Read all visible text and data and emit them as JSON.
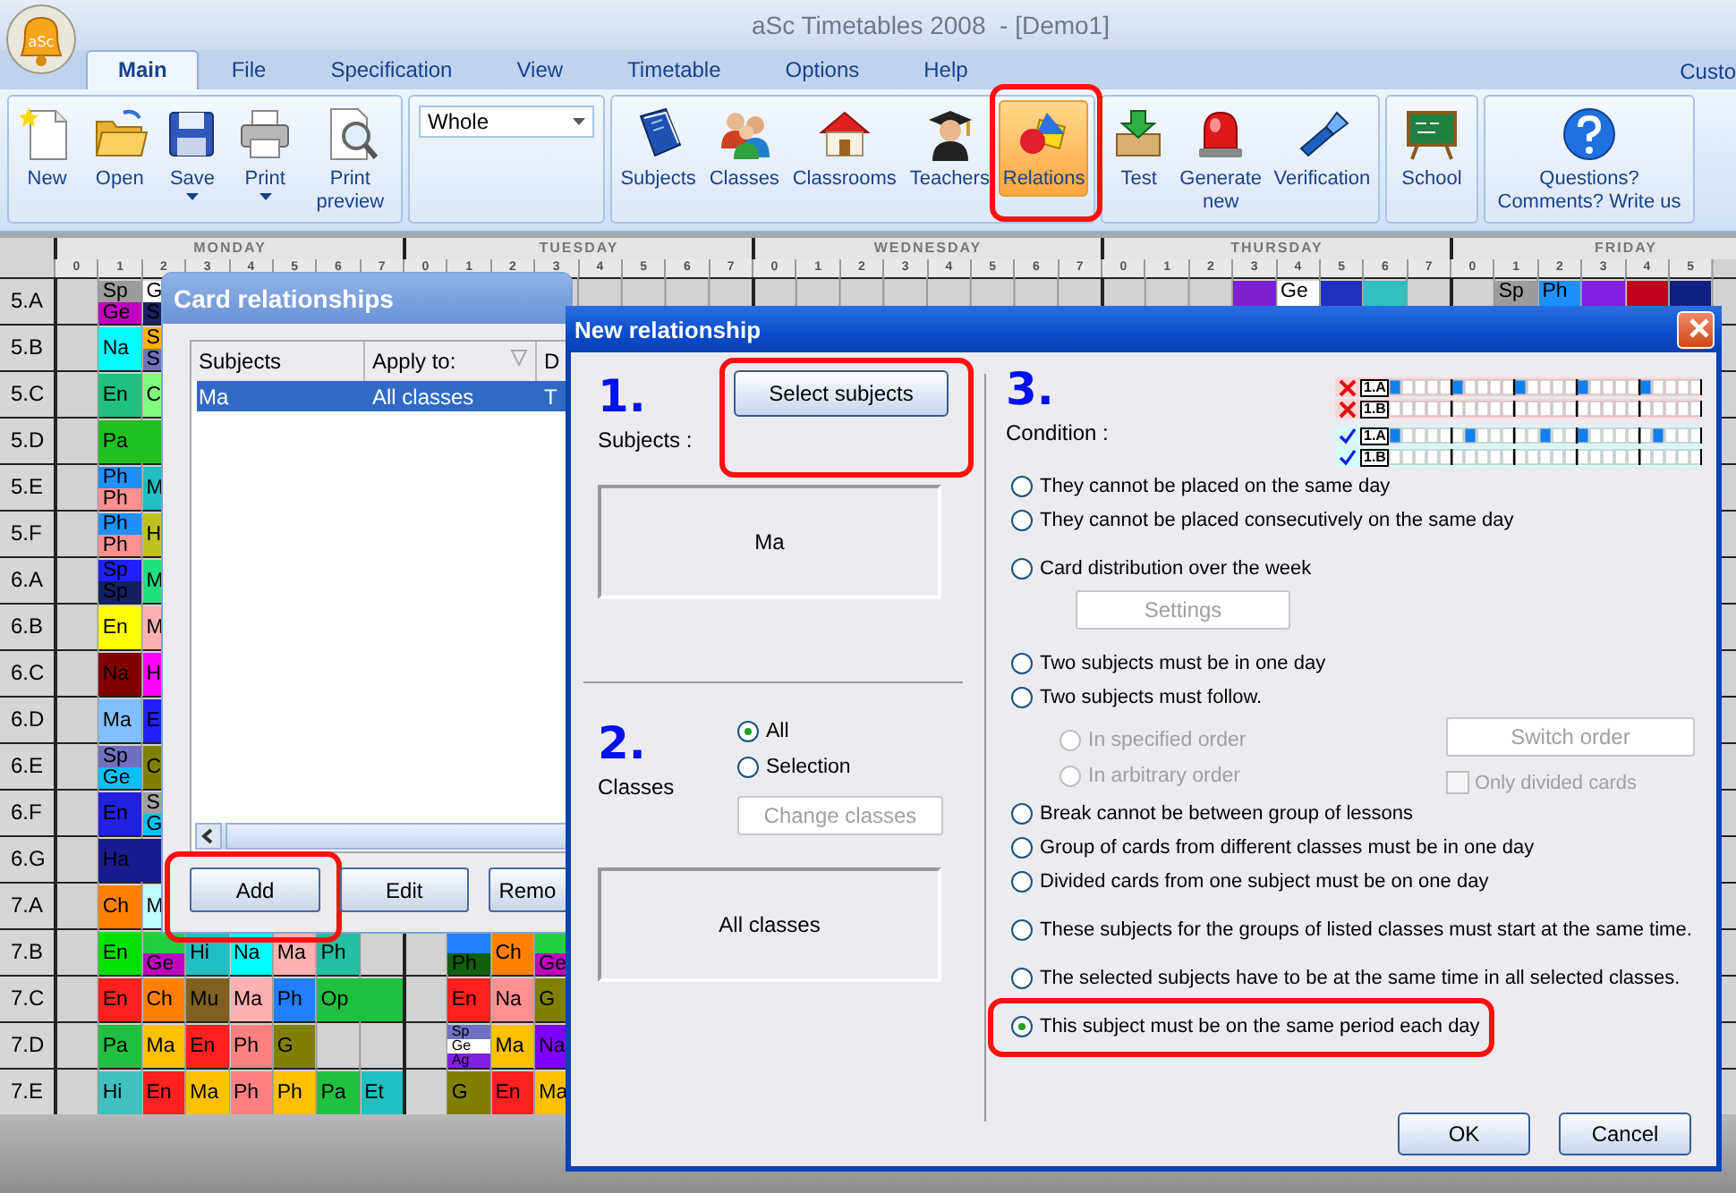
{
  "app_logo": {
    "text": "aSc"
  },
  "window": {
    "title": "aSc Timetables 2008  - [Demo1]"
  },
  "menu_tabs": [
    {
      "label": "Main",
      "selected": true
    },
    {
      "label": "File",
      "selected": false
    },
    {
      "label": "Specification",
      "selected": false
    },
    {
      "label": "View",
      "selected": false
    },
    {
      "label": "Timetable",
      "selected": false
    },
    {
      "label": "Options",
      "selected": false
    },
    {
      "label": "Help",
      "selected": false
    }
  ],
  "menu_right": "Custo",
  "ribbon": [
    {
      "items": [
        {
          "kind": "button",
          "label": "New",
          "selected": false,
          "has_menu": false,
          "highlighted": false
        },
        {
          "kind": "button",
          "label": "Open",
          "selected": false,
          "has_menu": false,
          "highlighted": false
        },
        {
          "kind": "button",
          "label": "Save",
          "selected": false,
          "has_menu": true,
          "highlighted": false
        },
        {
          "kind": "button",
          "label": "Print",
          "selected": false,
          "has_menu": true,
          "highlighted": false
        },
        {
          "kind": "button",
          "label": "Print preview",
          "selected": false,
          "has_menu": false,
          "highlighted": false
        }
      ]
    },
    {
      "items": [
        {
          "kind": "select",
          "value": "Whole"
        }
      ]
    },
    {
      "items": [
        {
          "kind": "button",
          "label": "Subjects",
          "selected": false,
          "has_menu": false,
          "highlighted": false
        },
        {
          "kind": "button",
          "label": "Classes",
          "selected": false,
          "has_menu": false,
          "highlighted": false
        },
        {
          "kind": "button",
          "label": "Classrooms",
          "selected": false,
          "has_menu": false,
          "highlighted": false
        },
        {
          "kind": "button",
          "label": "Teachers",
          "selected": false,
          "has_menu": false,
          "highlighted": false
        },
        {
          "kind": "button",
          "label": "Relations",
          "selected": true,
          "has_menu": false,
          "highlighted": true
        }
      ]
    },
    {
      "items": [
        {
          "kind": "button",
          "label": "Test",
          "selected": false,
          "has_menu": false,
          "highlighted": false
        },
        {
          "kind": "button",
          "label": "Generate new",
          "selected": false,
          "has_menu": false,
          "highlighted": false
        },
        {
          "kind": "button",
          "label": "Verification",
          "selected": false,
          "has_menu": false,
          "highlighted": false
        }
      ]
    },
    {
      "items": [
        {
          "kind": "button",
          "label": "School",
          "selected": false,
          "has_menu": false,
          "highlighted": false
        }
      ]
    },
    {
      "items": [
        {
          "kind": "button",
          "label": "Questions? Comments? Write us",
          "selected": false,
          "has_menu": false,
          "highlighted": false
        }
      ]
    }
  ],
  "timetable": {
    "days": [
      {
        "name": "MONDAY",
        "periods": [
          "0",
          "1",
          "2",
          "3",
          "4",
          "5",
          "6",
          "7"
        ]
      },
      {
        "name": "TUESDAY",
        "periods": [
          "0",
          "1",
          "2",
          "3",
          "4",
          "5",
          "6",
          "7"
        ]
      },
      {
        "name": "WEDNESDAY",
        "periods": [
          "0",
          "1",
          "2",
          "3",
          "4",
          "5",
          "6",
          "7"
        ]
      },
      {
        "name": "THURSDAY",
        "periods": [
          "0",
          "1",
          "2",
          "3",
          "4",
          "5",
          "6",
          "7"
        ]
      },
      {
        "name": "FRIDAY",
        "periods": [
          "0",
          "1",
          "2",
          "3",
          "4",
          "5"
        ]
      }
    ],
    "rows": [
      {
        "label": "5.A",
        "monday": [
          {
            "kind": "empty"
          },
          {
            "kind": "single",
            "parts": [
              {
                "text": "Sp",
                "color": "#9c9c9c"
              },
              {
                "text": "Ge",
                "color": "#c000c0"
              }
            ]
          },
          {
            "kind": "single",
            "parts": [
              {
                "text": "G",
                "color": "#ffffff"
              },
              {
                "text": "S",
                "color": "#1a2060"
              }
            ]
          }
        ],
        "thursday": [
          {
            "kind": "empty"
          },
          {
            "kind": "empty"
          },
          {
            "kind": "empty"
          },
          {
            "kind": "single",
            "parts": [
              {
                "color": "#7a20d0"
              },
              {
                "color": "#7a20d0"
              }
            ]
          },
          {
            "kind": "single",
            "parts": [
              {
                "text": "Ge",
                "color": "#ffffff"
              },
              {
                "color": "#ffffff"
              }
            ]
          },
          {
            "kind": "single",
            "parts": [
              {
                "color": "#2030c0"
              },
              {
                "color": "#2030c0"
              }
            ]
          },
          {
            "kind": "single",
            "parts": [
              {
                "color": "#30c0c0"
              },
              {
                "color": "#30c0c0"
              }
            ]
          }
        ],
        "friday": [
          {
            "kind": "empty"
          },
          {
            "kind": "single",
            "parts": [
              {
                "text": "Sp",
                "color": "#9c9c9c"
              },
              {
                "color": "#9c9c9c"
              }
            ]
          },
          {
            "kind": "single",
            "parts": [
              {
                "text": "Ph",
                "color": "#2090ff"
              },
              {
                "color": "#2090ff"
              }
            ]
          },
          {
            "kind": "single",
            "parts": [
              {
                "color": "#8020e0"
              },
              {
                "color": "#8020e0"
              }
            ]
          },
          {
            "kind": "single",
            "parts": [
              {
                "color": "#c00020"
              },
              {
                "color": "#c00020"
              }
            ]
          },
          {
            "kind": "single",
            "parts": [
              {
                "color": "#102080"
              },
              {
                "color": "#102080"
              }
            ]
          }
        ]
      },
      {
        "label": "5.B",
        "monday": [
          {
            "kind": "empty"
          },
          {
            "kind": "single",
            "parts": [
              {
                "text": "Na",
                "color": "#00ffff"
              }
            ]
          },
          {
            "kind": "single",
            "parts": [
              {
                "text": "S",
                "color": "#ffb000"
              },
              {
                "text": "S",
                "color": "#7070c0"
              }
            ]
          }
        ]
      },
      {
        "label": "5.C",
        "monday": [
          {
            "kind": "empty"
          },
          {
            "kind": "single",
            "parts": [
              {
                "text": "En",
                "color": "#20c080"
              }
            ]
          },
          {
            "kind": "single",
            "parts": [
              {
                "text": "C",
                "color": "#80ff80"
              }
            ]
          }
        ]
      },
      {
        "label": "5.D",
        "monday": [
          {
            "kind": "empty"
          },
          {
            "kind": "double",
            "parts": [
              {
                "text": "Pa",
                "color": "#20c020"
              }
            ]
          }
        ]
      },
      {
        "label": "5.E",
        "monday": [
          {
            "kind": "empty"
          },
          {
            "kind": "single",
            "parts": [
              {
                "text": "Ph",
                "color": "#2090ff"
              },
              {
                "text": "Ph",
                "color": "#ff9090"
              }
            ]
          },
          {
            "kind": "single",
            "parts": [
              {
                "text": "M",
                "color": "#20c0c0"
              }
            ]
          }
        ]
      },
      {
        "label": "5.F",
        "monday": [
          {
            "kind": "empty"
          },
          {
            "kind": "single",
            "parts": [
              {
                "text": "Ph",
                "color": "#2090ff"
              },
              {
                "text": "Ph",
                "color": "#ff9090"
              }
            ]
          },
          {
            "kind": "single",
            "parts": [
              {
                "text": "H",
                "color": "#c0c020"
              }
            ]
          }
        ]
      },
      {
        "label": "6.A",
        "monday": [
          {
            "kind": "empty"
          },
          {
            "kind": "single",
            "parts": [
              {
                "text": "Sp",
                "color": "#2020ff"
              },
              {
                "text": "Sp",
                "color": "#102060"
              }
            ]
          },
          {
            "kind": "single",
            "parts": [
              {
                "text": "M",
                "color": "#20e080"
              }
            ]
          }
        ]
      },
      {
        "label": "6.B",
        "monday": [
          {
            "kind": "empty"
          },
          {
            "kind": "single",
            "parts": [
              {
                "text": "En",
                "color": "#ffff00"
              }
            ]
          },
          {
            "kind": "single",
            "parts": [
              {
                "text": "M",
                "color": "#ffb0b0"
              }
            ]
          }
        ]
      },
      {
        "label": "6.C",
        "monday": [
          {
            "kind": "empty"
          },
          {
            "kind": "single",
            "parts": [
              {
                "text": "Na",
                "color": "#800000"
              }
            ]
          },
          {
            "kind": "single",
            "parts": [
              {
                "text": "H",
                "color": "#ff00ff"
              }
            ]
          }
        ]
      },
      {
        "label": "6.D",
        "monday": [
          {
            "kind": "empty"
          },
          {
            "kind": "single",
            "parts": [
              {
                "text": "Ma",
                "color": "#80c0ff"
              }
            ]
          },
          {
            "kind": "single",
            "parts": [
              {
                "text": "E",
                "color": "#2020ff"
              }
            ]
          }
        ]
      },
      {
        "label": "6.E",
        "monday": [
          {
            "kind": "empty"
          },
          {
            "kind": "single",
            "parts": [
              {
                "text": "Sp",
                "color": "#7070c0"
              },
              {
                "text": "Ge",
                "color": "#00c0ff"
              }
            ]
          },
          {
            "kind": "single",
            "parts": [
              {
                "text": "C",
                "color": "#808000"
              }
            ]
          }
        ]
      },
      {
        "label": "6.F",
        "monday": [
          {
            "kind": "empty"
          },
          {
            "kind": "single",
            "parts": [
              {
                "text": "En",
                "color": "#2020e0"
              }
            ]
          },
          {
            "kind": "single",
            "parts": [
              {
                "text": "S",
                "color": "#a0a0a0"
              },
              {
                "text": "G",
                "color": "#00c0ff"
              }
            ]
          }
        ]
      },
      {
        "label": "6.G",
        "monday": [
          {
            "kind": "empty"
          },
          {
            "kind": "double",
            "parts": [
              {
                "text": "Ha",
                "color": "#1a1a90"
              }
            ]
          }
        ]
      },
      {
        "label": "7.A",
        "monday": [
          {
            "kind": "empty"
          },
          {
            "kind": "single",
            "parts": [
              {
                "text": "Ch",
                "color": "#ff8000"
              }
            ]
          },
          {
            "kind": "single",
            "parts": [
              {
                "text": "M",
                "color": "#c0ffff"
              }
            ]
          }
        ]
      },
      {
        "label": "7.B",
        "monday": [
          {
            "kind": "empty"
          },
          {
            "kind": "single",
            "parts": [
              {
                "text": "En",
                "color": "#00e000"
              }
            ]
          },
          {
            "kind": "single",
            "parts": [
              {
                "color": "#20d040"
              },
              {
                "text": "Ge",
                "color": "#c000c0"
              }
            ]
          },
          {
            "kind": "single",
            "parts": [
              {
                "text": "Hi",
                "color": "#20c0c0"
              }
            ]
          },
          {
            "kind": "single",
            "parts": [
              {
                "text": "Na",
                "color": "#00ffff"
              }
            ]
          },
          {
            "kind": "single",
            "parts": [
              {
                "text": "Ma",
                "color": "#ffb0b0"
              }
            ]
          },
          {
            "kind": "single",
            "parts": [
              {
                "text": "Ph",
                "color": "#20c0a0"
              }
            ]
          }
        ],
        "tuesday": [
          {
            "kind": "empty"
          },
          {
            "kind": "single",
            "parts": [
              {
                "color": "#2080ff"
              },
              {
                "text": "Ph",
                "color": "#106010"
              }
            ]
          },
          {
            "kind": "single",
            "parts": [
              {
                "text": "Ch",
                "color": "#ff8000"
              }
            ]
          },
          {
            "kind": "single",
            "parts": [
              {
                "color": "#20d040"
              },
              {
                "text": "Ge",
                "color": "#c000c0"
              }
            ]
          }
        ]
      },
      {
        "label": "7.C",
        "monday": [
          {
            "kind": "empty"
          },
          {
            "kind": "single",
            "parts": [
              {
                "text": "En",
                "color": "#ff2020"
              }
            ]
          },
          {
            "kind": "single",
            "parts": [
              {
                "text": "Ch",
                "color": "#ff8000"
              }
            ]
          },
          {
            "kind": "single",
            "parts": [
              {
                "text": "Mu",
                "color": "#806020"
              }
            ]
          },
          {
            "kind": "single",
            "parts": [
              {
                "text": "Ma",
                "color": "#ffb0b0"
              }
            ]
          },
          {
            "kind": "single",
            "parts": [
              {
                "text": "Ph",
                "color": "#2080ff"
              }
            ]
          },
          {
            "kind": "double",
            "parts": [
              {
                "text": "Op",
                "color": "#20c040"
              }
            ]
          }
        ],
        "tuesday": [
          {
            "kind": "empty"
          },
          {
            "kind": "single",
            "parts": [
              {
                "text": "En",
                "color": "#ff2020"
              }
            ]
          },
          {
            "kind": "single",
            "parts": [
              {
                "text": "Na",
                "color": "#ff9090"
              }
            ]
          },
          {
            "kind": "single",
            "parts": [
              {
                "text": "G",
                "color": "#808000"
              }
            ]
          }
        ]
      },
      {
        "label": "7.D",
        "monday": [
          {
            "kind": "empty"
          },
          {
            "kind": "single",
            "parts": [
              {
                "text": "Pa",
                "color": "#20c040"
              }
            ]
          },
          {
            "kind": "single",
            "parts": [
              {
                "text": "Ma",
                "color": "#ffc000"
              }
            ]
          },
          {
            "kind": "single",
            "parts": [
              {
                "text": "En",
                "color": "#ff2020"
              }
            ]
          },
          {
            "kind": "single",
            "parts": [
              {
                "text": "Ph",
                "color": "#ff8080"
              }
            ]
          },
          {
            "kind": "single",
            "parts": [
              {
                "text": "G",
                "color": "#808000"
              }
            ]
          }
        ],
        "tuesday": [
          {
            "kind": "empty"
          },
          {
            "kind": "single",
            "parts": [
              {
                "text": "Sp",
                "color": "#7070c0"
              },
              {
                "text": "Ge",
                "color": "#ffffff"
              },
              {
                "text": "Ag",
                "color": "#8020e0"
              }
            ]
          },
          {
            "kind": "single",
            "parts": [
              {
                "text": "Ma",
                "color": "#ffc000"
              }
            ]
          },
          {
            "kind": "single",
            "parts": [
              {
                "text": "Na",
                "color": "#8000ff"
              }
            ]
          }
        ]
      },
      {
        "label": "7.E",
        "monday": [
          {
            "kind": "empty"
          },
          {
            "kind": "single",
            "parts": [
              {
                "text": "Hi",
                "color": "#40c0c0"
              }
            ]
          },
          {
            "kind": "single",
            "parts": [
              {
                "text": "En",
                "color": "#ff2020"
              }
            ]
          },
          {
            "kind": "single",
            "parts": [
              {
                "text": "Ma",
                "color": "#ffc000"
              }
            ]
          },
          {
            "kind": "single",
            "parts": [
              {
                "text": "Ph",
                "color": "#ff8080"
              }
            ]
          },
          {
            "kind": "single",
            "parts": [
              {
                "text": "Ph",
                "color": "#ffc000"
              }
            ]
          },
          {
            "kind": "single",
            "parts": [
              {
                "text": "Pa",
                "color": "#20c040"
              }
            ]
          },
          {
            "kind": "single",
            "parts": [
              {
                "text": "Et",
                "color": "#20c0c0"
              }
            ]
          }
        ],
        "tuesday": [
          {
            "kind": "empty"
          },
          {
            "kind": "single",
            "parts": [
              {
                "text": "G",
                "color": "#808000"
              }
            ]
          },
          {
            "kind": "single",
            "parts": [
              {
                "text": "En",
                "color": "#ff2020"
              }
            ]
          },
          {
            "kind": "single",
            "parts": [
              {
                "text": "Ma",
                "color": "#ffc000"
              }
            ]
          }
        ]
      }
    ]
  },
  "card_relationships": {
    "title": "Card relationships",
    "columns": [
      "Subjects",
      "Apply to:",
      "D"
    ],
    "rows": [
      {
        "cells": [
          "Ma",
          "All classes",
          "T"
        ],
        "selected": true
      }
    ],
    "buttons": [
      {
        "label": "Add",
        "highlighted": true
      },
      {
        "label": "Edit"
      },
      {
        "label": "Remo"
      }
    ]
  },
  "new_relationship": {
    "title": "New relationship",
    "subjects": {
      "number": "1.",
      "label": "Subjects :",
      "button": {
        "label": "Select subjects",
        "highlighted": true
      },
      "value": "Ma"
    },
    "classes": {
      "number": "2.",
      "label": "Classes",
      "options": [
        {
          "label": "All",
          "selected": true
        },
        {
          "label": "Selection",
          "selected": false
        }
      ],
      "button": {
        "label": "Change classes",
        "disabled": true
      },
      "value": "All classes"
    },
    "condition": {
      "number": "3.",
      "label": "Condition :",
      "example": [
        {
          "label": "1.A",
          "allowed": false,
          "filled": [
            true,
            false,
            false,
            false,
            false,
            true,
            false,
            false,
            false,
            false,
            true,
            false,
            false,
            false,
            false,
            true,
            false,
            false,
            false,
            false,
            true,
            false,
            false,
            false,
            false
          ]
        },
        {
          "label": "1.B",
          "allowed": false,
          "filled": [
            false,
            false,
            false,
            false,
            false,
            false,
            false,
            false,
            false,
            false,
            false,
            false,
            false,
            false,
            false,
            false,
            false,
            false,
            false,
            false,
            false,
            false,
            false,
            false,
            false
          ]
        },
        {
          "label": "1.A",
          "allowed": true,
          "filled": [
            true,
            false,
            false,
            false,
            false,
            false,
            true,
            false,
            false,
            false,
            false,
            false,
            true,
            false,
            false,
            true,
            false,
            false,
            false,
            false,
            false,
            true,
            false,
            false,
            false
          ]
        },
        {
          "label": "1.B",
          "allowed": true,
          "filled": [
            false,
            false,
            false,
            false,
            false,
            false,
            false,
            false,
            false,
            false,
            false,
            false,
            false,
            false,
            false,
            false,
            false,
            false,
            false,
            false,
            false,
            false,
            false,
            false,
            false
          ]
        }
      ],
      "groups": [
        [
          {
            "kind": "radio",
            "label": "They cannot be placed on the same day",
            "selected": false,
            "highlighted": false
          },
          {
            "kind": "radio",
            "label": "They cannot be placed consecutively on the same day",
            "selected": false,
            "highlighted": false
          }
        ],
        [
          {
            "kind": "radio",
            "label": "Card distribution over the week",
            "selected": false,
            "highlighted": false
          },
          {
            "kind": "button",
            "label": "Settings",
            "disabled": true
          }
        ],
        [
          {
            "kind": "radio",
            "label": "Two subjects must be in one day",
            "selected": false,
            "highlighted": false
          },
          {
            "kind": "radio",
            "label": "Two subjects must follow.",
            "selected": false,
            "highlighted": false
          },
          {
            "kind": "suboptions",
            "options": [
              {
                "label": "In specified order",
                "selected": false,
                "disabled": true
              },
              {
                "label": "In arbitrary order",
                "selected": false,
                "disabled": true
              }
            ],
            "button": {
              "label": "Switch order",
              "disabled": true
            },
            "checkbox": {
              "label": "Only divided cards",
              "checked": false,
              "disabled": true
            }
          },
          {
            "kind": "radio",
            "label": "Break cannot be between group of lessons",
            "selected": false,
            "highlighted": false
          },
          {
            "kind": "radio",
            "label": "Group of cards from different classes must be in one day",
            "selected": false,
            "highlighted": false
          },
          {
            "kind": "radio",
            "label": "Divided cards from one subject must be on one day",
            "selected": false,
            "highlighted": false
          }
        ],
        [
          {
            "kind": "radio",
            "label": "These subjects for the groups of listed classes must start at the same time.",
            "selected": false,
            "highlighted": false
          }
        ],
        [
          {
            "kind": "radio",
            "label": "The selected subjects have to be at the same time in all selected classes.",
            "selected": false,
            "highlighted": false
          }
        ],
        [
          {
            "kind": "radio",
            "label": "This subject must be on the same period each day",
            "selected": true,
            "highlighted": true
          }
        ]
      ]
    },
    "buttons": [
      "OK",
      "Cancel"
    ]
  }
}
